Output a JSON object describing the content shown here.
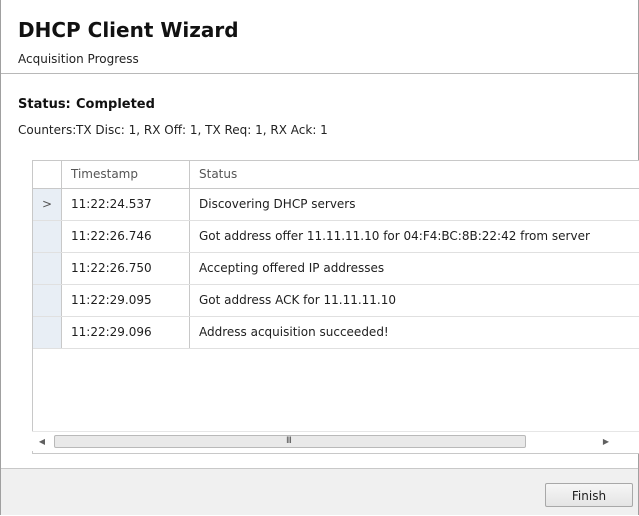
{
  "header": {
    "title": "DHCP Client Wizard",
    "subtitle": "Acquisition Progress"
  },
  "status": {
    "label": "Status:",
    "value": "Completed"
  },
  "counters": {
    "label": "Counters:",
    "value": "TX Disc: 1, RX Off: 1, TX Req: 1, RX Ack: 1"
  },
  "grid": {
    "columns": [
      "Timestamp",
      "Status"
    ],
    "current_row_marker": ">",
    "rows": [
      {
        "timestamp": "11:22:24.537",
        "status": "Discovering DHCP servers"
      },
      {
        "timestamp": "11:22:26.746",
        "status": "Got address offer 11.11.11.10 for 04:F4:BC:8B:22:42 from server"
      },
      {
        "timestamp": "11:22:26.750",
        "status": "Accepting offered IP addresses"
      },
      {
        "timestamp": "11:22:29.095",
        "status": "Got address ACK for 11.11.11.10"
      },
      {
        "timestamp": "11:22:29.096",
        "status": "Address acquisition succeeded!"
      }
    ]
  },
  "scrollbar": {
    "left_icon": "scroll-left-icon",
    "right_icon": "scroll-right-icon",
    "grip": "III"
  },
  "footer": {
    "finish_label": "Finish"
  },
  "colors": {
    "row_selector_bg": "#e8eef5",
    "footer_bg": "#f0f0f0",
    "border": "#c8c8c8"
  }
}
